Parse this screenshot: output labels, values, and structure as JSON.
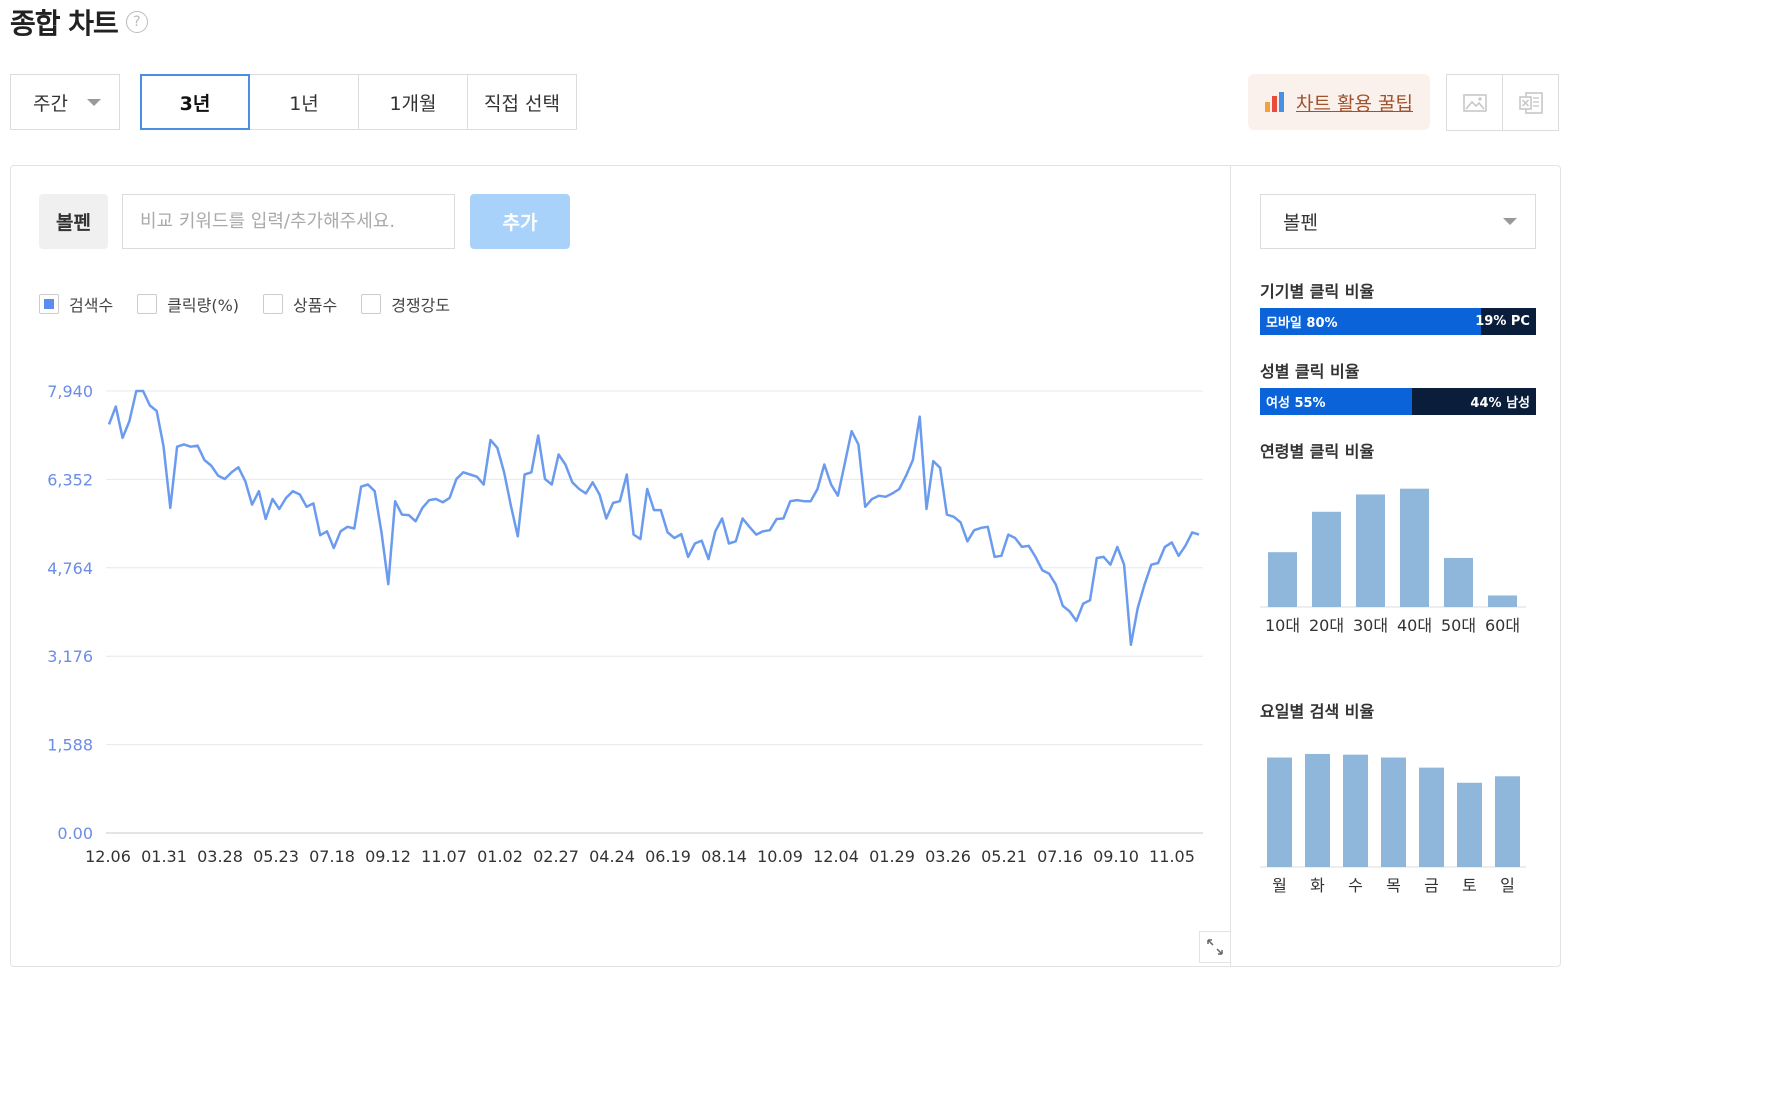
{
  "page": {
    "title": "종합 차트",
    "help_icon": "?"
  },
  "controls": {
    "period": "주간",
    "tabs": [
      "3년",
      "1년",
      "1개월",
      "직접 선택"
    ],
    "active_tab": "3년",
    "tip_button": "차트 활용 꿀팁",
    "export_icons": [
      "image-icon",
      "excel-icon"
    ]
  },
  "search": {
    "keyword": "볼펜",
    "placeholder": "비교 키워드를 입력/추가해주세요.",
    "add_button": "추가"
  },
  "legend": [
    {
      "label": "검색수",
      "checked": true
    },
    {
      "label": "클릭량(%)",
      "checked": false
    },
    {
      "label": "상품수",
      "checked": false
    },
    {
      "label": "경쟁강도",
      "checked": false
    }
  ],
  "chart_data": [
    {
      "type": "line",
      "title": "",
      "color": "#6b9bef",
      "ylim": [
        0,
        7940
      ],
      "yticks": [
        "7,940",
        "6,352",
        "4,764",
        "3,176",
        "1,588",
        "0.00"
      ],
      "xticks": [
        "12.06",
        "01.31",
        "03.28",
        "05.23",
        "07.18",
        "09.12",
        "11.07",
        "01.02",
        "02.27",
        "04.24",
        "06.19",
        "08.14",
        "10.09",
        "12.04",
        "01.29",
        "03.26",
        "05.21",
        "07.16",
        "09.10",
        "11.05"
      ],
      "series": [
        {
          "name": "검색수",
          "values": [
            7340,
            7660,
            7100,
            7400,
            7940,
            7940,
            7680,
            7580,
            6950,
            5840,
            6940,
            6980,
            6940,
            6960,
            6700,
            6600,
            6420,
            6360,
            6480,
            6570,
            6320,
            5900,
            6140,
            5640,
            6000,
            5820,
            6020,
            6140,
            6080,
            5860,
            5920,
            5350,
            5420,
            5120,
            5420,
            5500,
            5470,
            6220,
            6260,
            6140,
            5400,
            4470,
            5960,
            5720,
            5710,
            5600,
            5840,
            5980,
            6000,
            5940,
            6020,
            6360,
            6480,
            6440,
            6400,
            6260,
            7060,
            6920,
            6480,
            5880,
            5330,
            6440,
            6480,
            7140,
            6360,
            6260,
            6800,
            6620,
            6300,
            6180,
            6100,
            6300,
            6080,
            5650,
            5930,
            5960,
            6440,
            5360,
            5280,
            6180,
            5800,
            5800,
            5400,
            5300,
            5370,
            4960,
            5200,
            5250,
            4920,
            5420,
            5650,
            5200,
            5240,
            5650,
            5500,
            5360,
            5420,
            5440,
            5640,
            5650,
            5960,
            5980,
            5960,
            5960,
            6180,
            6620,
            6260,
            6060,
            6640,
            7220,
            6980,
            5860,
            6000,
            6060,
            6040,
            6100,
            6180,
            6420,
            6700,
            7480,
            5820,
            6680,
            6560,
            5720,
            5680,
            5580,
            5240,
            5440,
            5480,
            5500,
            4960,
            4980,
            5360,
            5300,
            5140,
            5160,
            4960,
            4720,
            4660,
            4460,
            4080,
            3980,
            3810,
            4120,
            4180,
            4940,
            4960,
            4820,
            5140,
            4820,
            3380,
            4040,
            4460,
            4820,
            4850,
            5140,
            5220,
            4980,
            5160,
            5400,
            5360
          ]
        }
      ]
    },
    {
      "type": "bar",
      "title": "연령별 클릭 비율",
      "color": "#8fb7db",
      "categories": [
        "10대",
        "20대",
        "30대",
        "40대",
        "50대",
        "60대"
      ],
      "values": [
        9.5,
        16.5,
        19.5,
        20.5,
        8.5,
        2.0
      ]
    },
    {
      "type": "bar",
      "title": "요일별 검색 비율",
      "color": "#8fb7db",
      "categories": [
        "월",
        "화",
        "수",
        "목",
        "금",
        "토",
        "일"
      ],
      "values": [
        15.2,
        15.7,
        15.6,
        15.2,
        13.8,
        11.7,
        12.6
      ]
    }
  ],
  "sidebar": {
    "keyword": "볼펜",
    "device": {
      "title": "기기별 클릭 비율",
      "left_label": "모바일 80%",
      "right_label": "19% PC",
      "left_pct": 80,
      "left_color": "#0b63d9",
      "right_color": "#0a1e3b"
    },
    "gender": {
      "title": "성별 클릭 비율",
      "left_label": "여성 55%",
      "right_label": "44% 남성",
      "left_pct": 55,
      "left_color": "#0b63d9",
      "right_color": "#0a1e3b"
    },
    "age_title": "연령별 클릭 비율",
    "weekday_title": "요일별 검색 비율"
  }
}
